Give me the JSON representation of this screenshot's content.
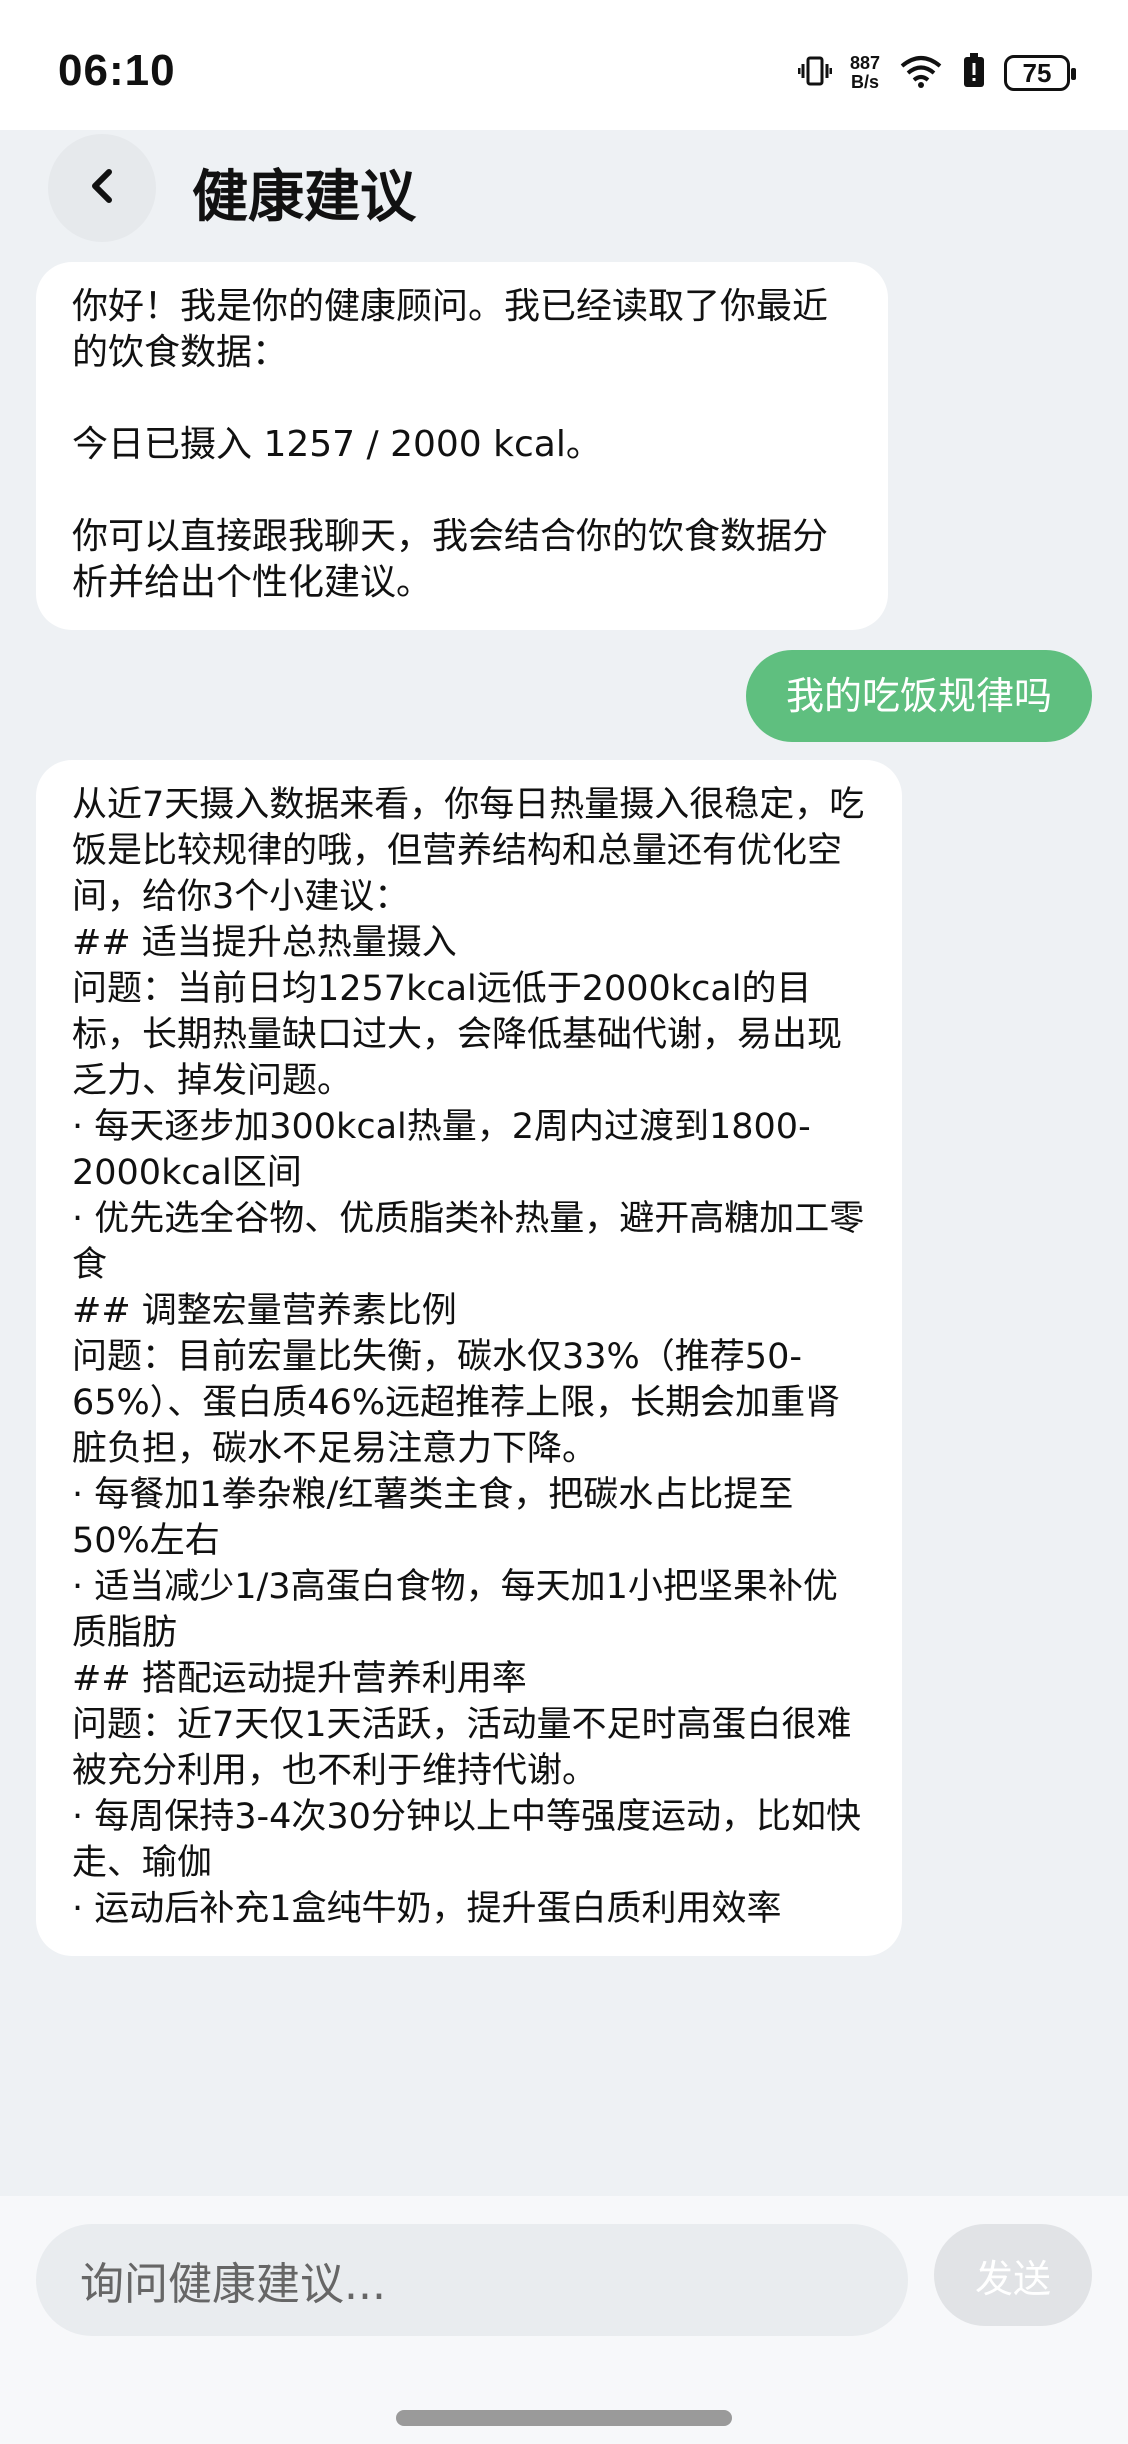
{
  "status_bar": {
    "time": "06:10",
    "net_speed_value": "887",
    "net_speed_unit": "B/s",
    "battery": "75",
    "icons": [
      "vibrate-icon",
      "wifi-icon",
      "battery-saver-icon",
      "battery-icon"
    ]
  },
  "header": {
    "back_icon": "chevron-left-icon",
    "title": "健康建议"
  },
  "messages": [
    {
      "role": "assistant",
      "text": "你好！我是你的健康顾问。我已经读取了你最近的饮食数据：\n\n今日已摄入 1257 / 2000 kcal。\n\n你可以直接跟我聊天，我会结合你的饮食数据分析并给出个性化建议。"
    },
    {
      "role": "user",
      "text": "我的吃饭规律吗"
    },
    {
      "role": "assistant",
      "text": "从近7天摄入数据来看，你每日热量摄入很稳定，吃饭是比较规律的哦，但营养结构和总量还有优化空间，给你3个小建议：\n## 适当提升总热量摄入\n问题：当前日均1257kcal远低于2000kcal的目标，长期热量缺口过大，会降低基础代谢，易出现乏力、掉发问题。\n· 每天逐步加300kcal热量，2周内过渡到1800-2000kcal区间\n· 优先选全谷物、优质脂类补热量，避开高糖加工零食\n## 调整宏量营养素比例\n问题：目前宏量比失衡，碳水仅33%（推荐50-65%）、蛋白质46%远超推荐上限，长期会加重肾脏负担，碳水不足易注意力下降。\n· 每餐加1拳杂粮/红薯类主食，把碳水占比提至50%左右\n· 适当减少1/3高蛋白食物，每天加1小把坚果补优质脂肪\n## 搭配运动提升营养利用率\n问题：近7天仅1天活跃，活动量不足时高蛋白很难被充分利用，也不利于维持代谢。\n· 每周保持3-4次30分钟以上中等强度运动，比如快走、瑜伽\n· 运动后补充1盒纯牛奶，提升蛋白质利用效率"
    }
  ],
  "input": {
    "placeholder": "询问健康建议...",
    "send_label": "发送"
  },
  "colors": {
    "user_bubble": "#5fbf7f",
    "background": "#eef1f4",
    "bot_bubble": "#ffffff"
  }
}
